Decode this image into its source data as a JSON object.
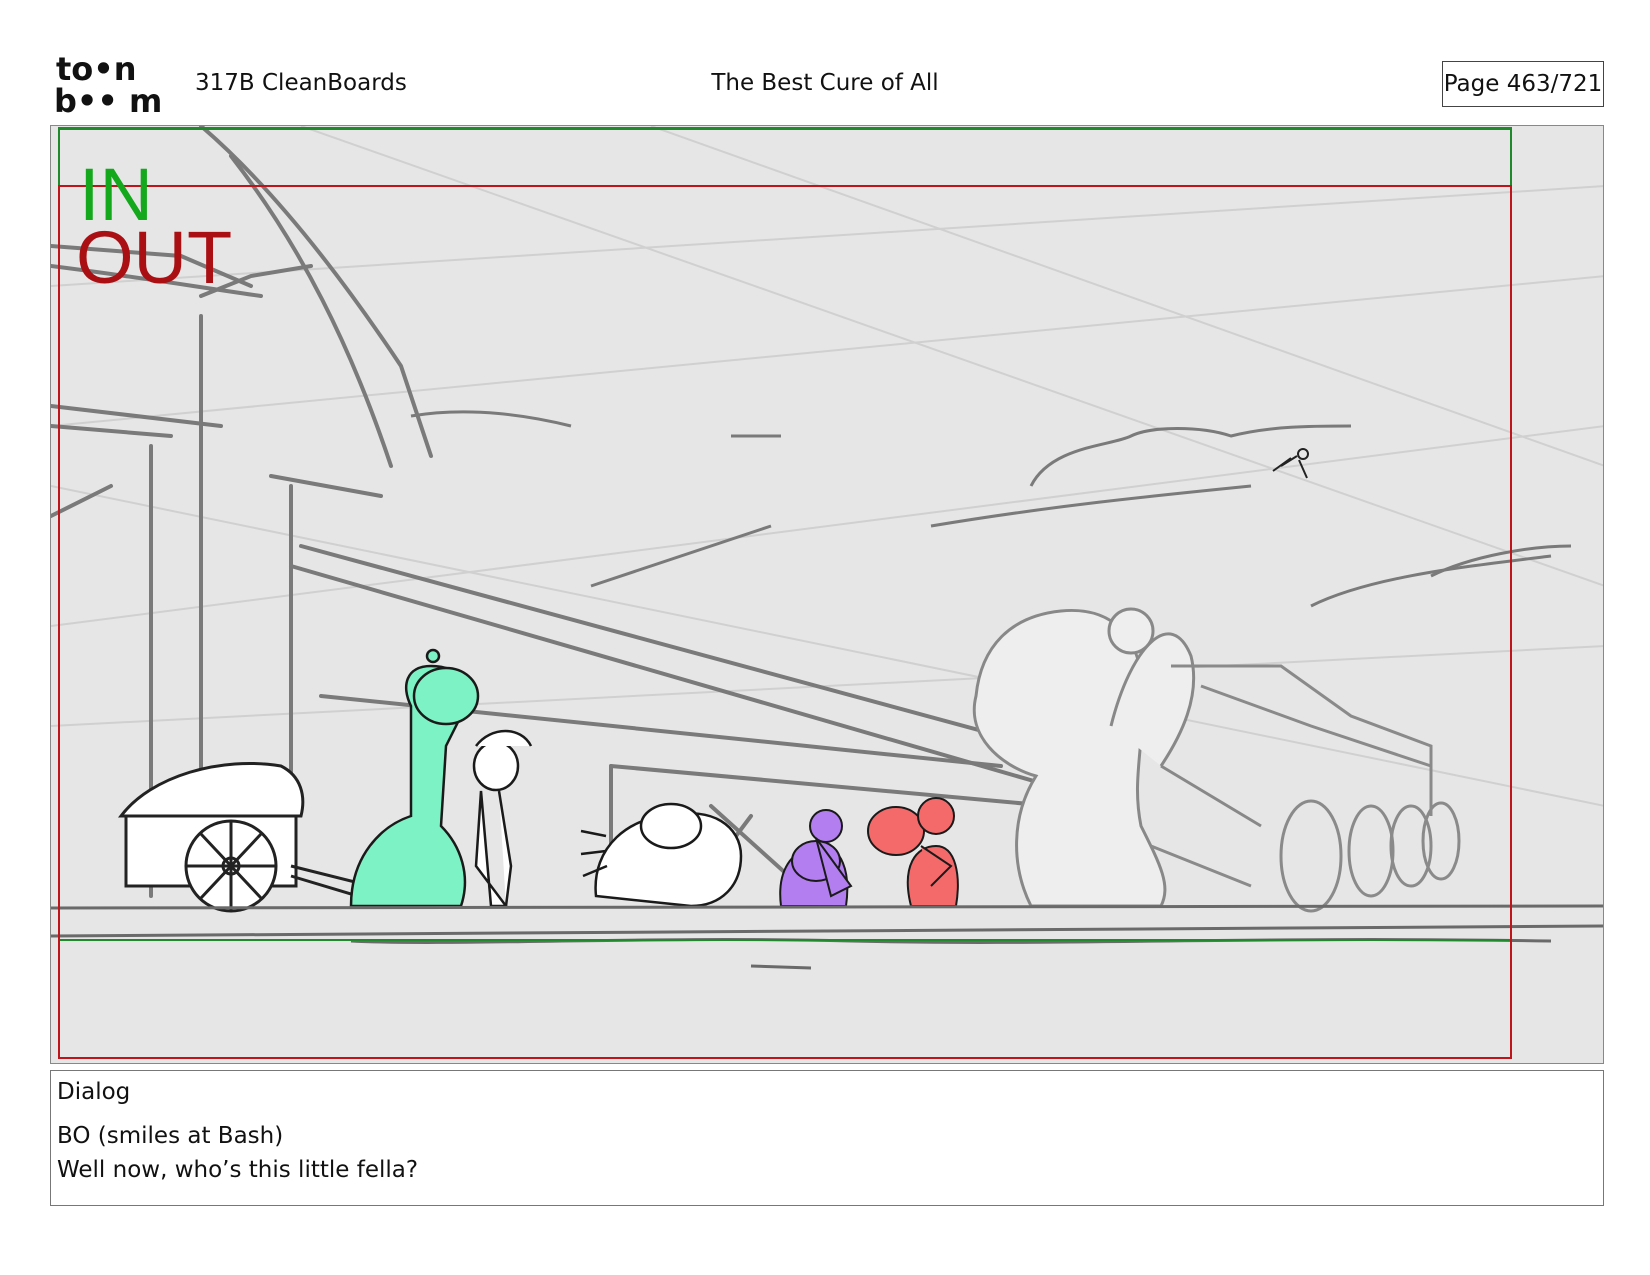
{
  "header": {
    "logo_top": "to•n",
    "logo_bottom": "b•• m",
    "episode": "317B  CleanBoards",
    "title": "The Best Cure of All",
    "page": "Page 463/721"
  },
  "panel": {
    "in_label": "IN",
    "out_label": "OUT",
    "colors": {
      "in_frame": "#1e8a2a",
      "out_frame": "#c0141c",
      "sketch": "#777777",
      "green_char": "#7df2c4",
      "purple_char": "#b27ef0",
      "red_char": "#f46a6a"
    }
  },
  "dialog": {
    "heading": "Dialog",
    "lines": [
      "BO (smiles at Bash)",
      "Well now, who’s this little fella?"
    ]
  }
}
